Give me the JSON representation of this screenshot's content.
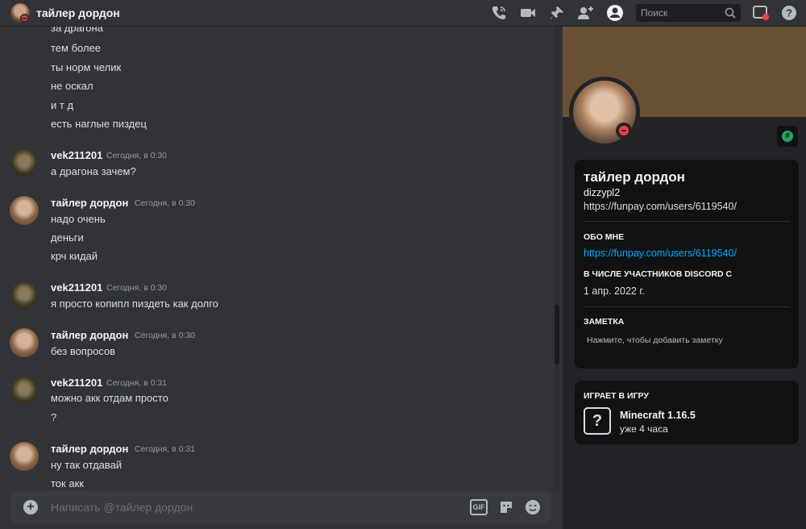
{
  "header": {
    "title": "тайлер дордон",
    "search_placeholder": "Поиск",
    "icons": [
      "phone-call-icon",
      "video-camera-icon",
      "pin-icon",
      "add-member-icon",
      "user-profile-icon",
      "inbox-icon",
      "help-icon"
    ]
  },
  "messages": {
    "top_partial": "за драгона",
    "top_lines": [
      "тем более",
      "ты норм челик",
      "не оскал",
      "и т д",
      "есть наглые пиздец"
    ],
    "groups": [
      {
        "author": "vek211201",
        "time": "Сегодня, в 0:30",
        "lines": [
          "а драгона зачем?"
        ]
      },
      {
        "author": "тайлер дордон",
        "time": "Сегодня, в 0:30",
        "lines": [
          "надо очень",
          "деньги",
          "крч кидай"
        ]
      },
      {
        "author": "vek211201",
        "time": "Сегодня, в 0:30",
        "lines": [
          "я просто копипл пиздеть как долго"
        ]
      },
      {
        "author": "тайлер дордон",
        "time": "Сегодня, в 0:30",
        "lines": [
          "без вопросов"
        ]
      },
      {
        "author": "vek211201",
        "time": "Сегодня, в 0:31",
        "lines": [
          "можно акк отдам просто",
          "?"
        ]
      },
      {
        "author": "тайлер дордон",
        "time": "Сегодня, в 0:31",
        "lines": [
          "ну так отдавай",
          "ток акк"
        ]
      }
    ]
  },
  "composer": {
    "placeholder": "Написать @тайлер дордон",
    "gif_label": "GIF"
  },
  "profile": {
    "name": "тайлер дордон",
    "username": "dizzypl2",
    "custom_status": "https://funpay.com/users/6119540/",
    "about_heading": "ОБО МНЕ",
    "about_link": "https://funpay.com/users/6119540/",
    "member_since_heading": "В ЧИСЛЕ УЧАСТНИКОВ DISCORD С",
    "member_since": "1 апр. 2022 г.",
    "note_heading": "ЗАМЕТКА",
    "note_placeholder": "Нажмите, чтобы добавить заметку",
    "activity_heading": "ИГРАЕТ В ИГРУ",
    "game_name": "Minecraft 1.16.5",
    "game_time": "уже 4 часа"
  },
  "colors": {
    "background": "#313338",
    "panel": "#232428",
    "card": "#111214",
    "link": "#00a8fc",
    "dnd_status": "#f23f43",
    "banner": "#6b5134"
  }
}
